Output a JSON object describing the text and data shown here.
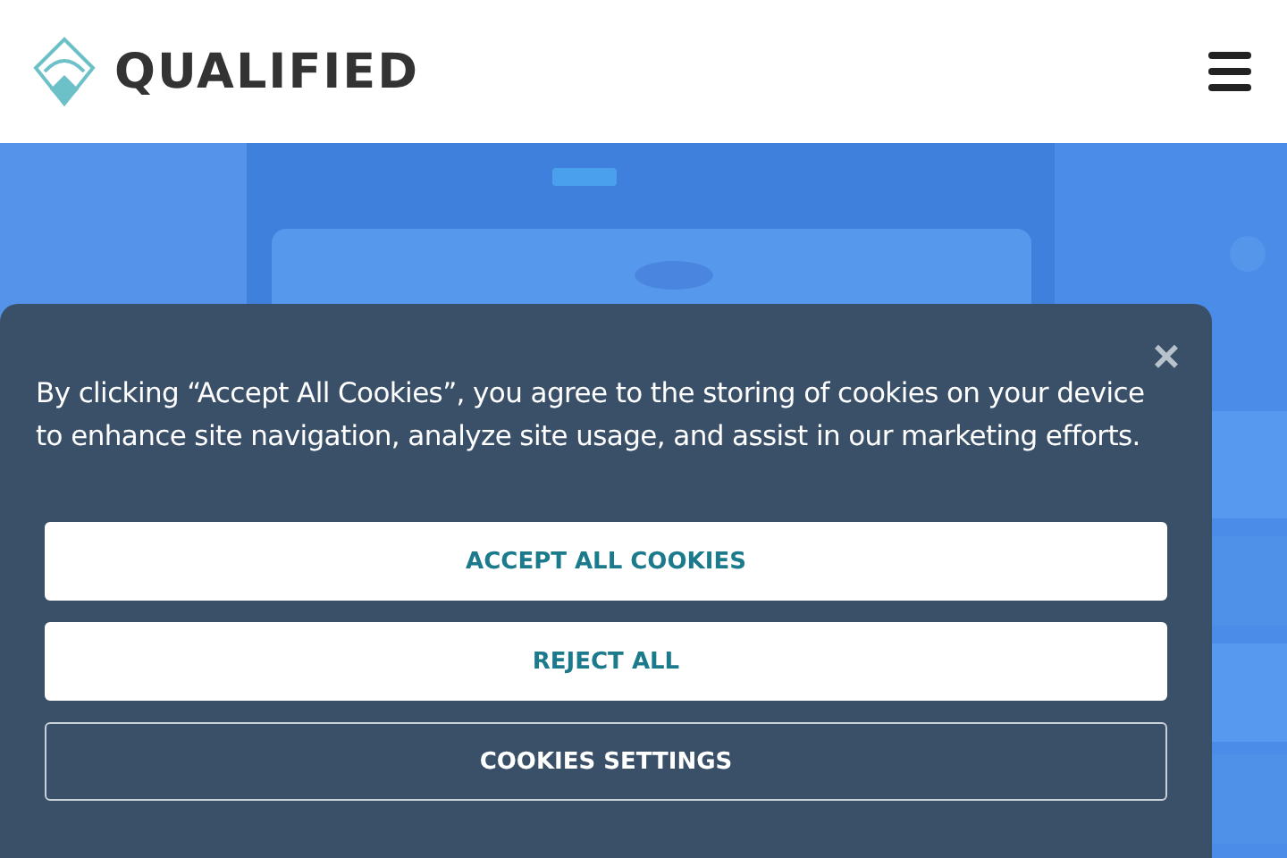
{
  "header": {
    "logo_text": "QUALIFIED"
  },
  "cookie_banner": {
    "message": "By clicking “Accept All Cookies”, you agree to the storing of cookies on your device to enhance site navigation, analyze site usage, and assist in our marketing efforts.",
    "close": "×",
    "buttons": [
      {
        "label": "ACCEPT ALL COOKIES",
        "kind": "filled"
      },
      {
        "label": "REJECT ALL",
        "kind": "filled"
      },
      {
        "label": "COOKIES SETTINGS",
        "kind": "outline"
      }
    ]
  }
}
